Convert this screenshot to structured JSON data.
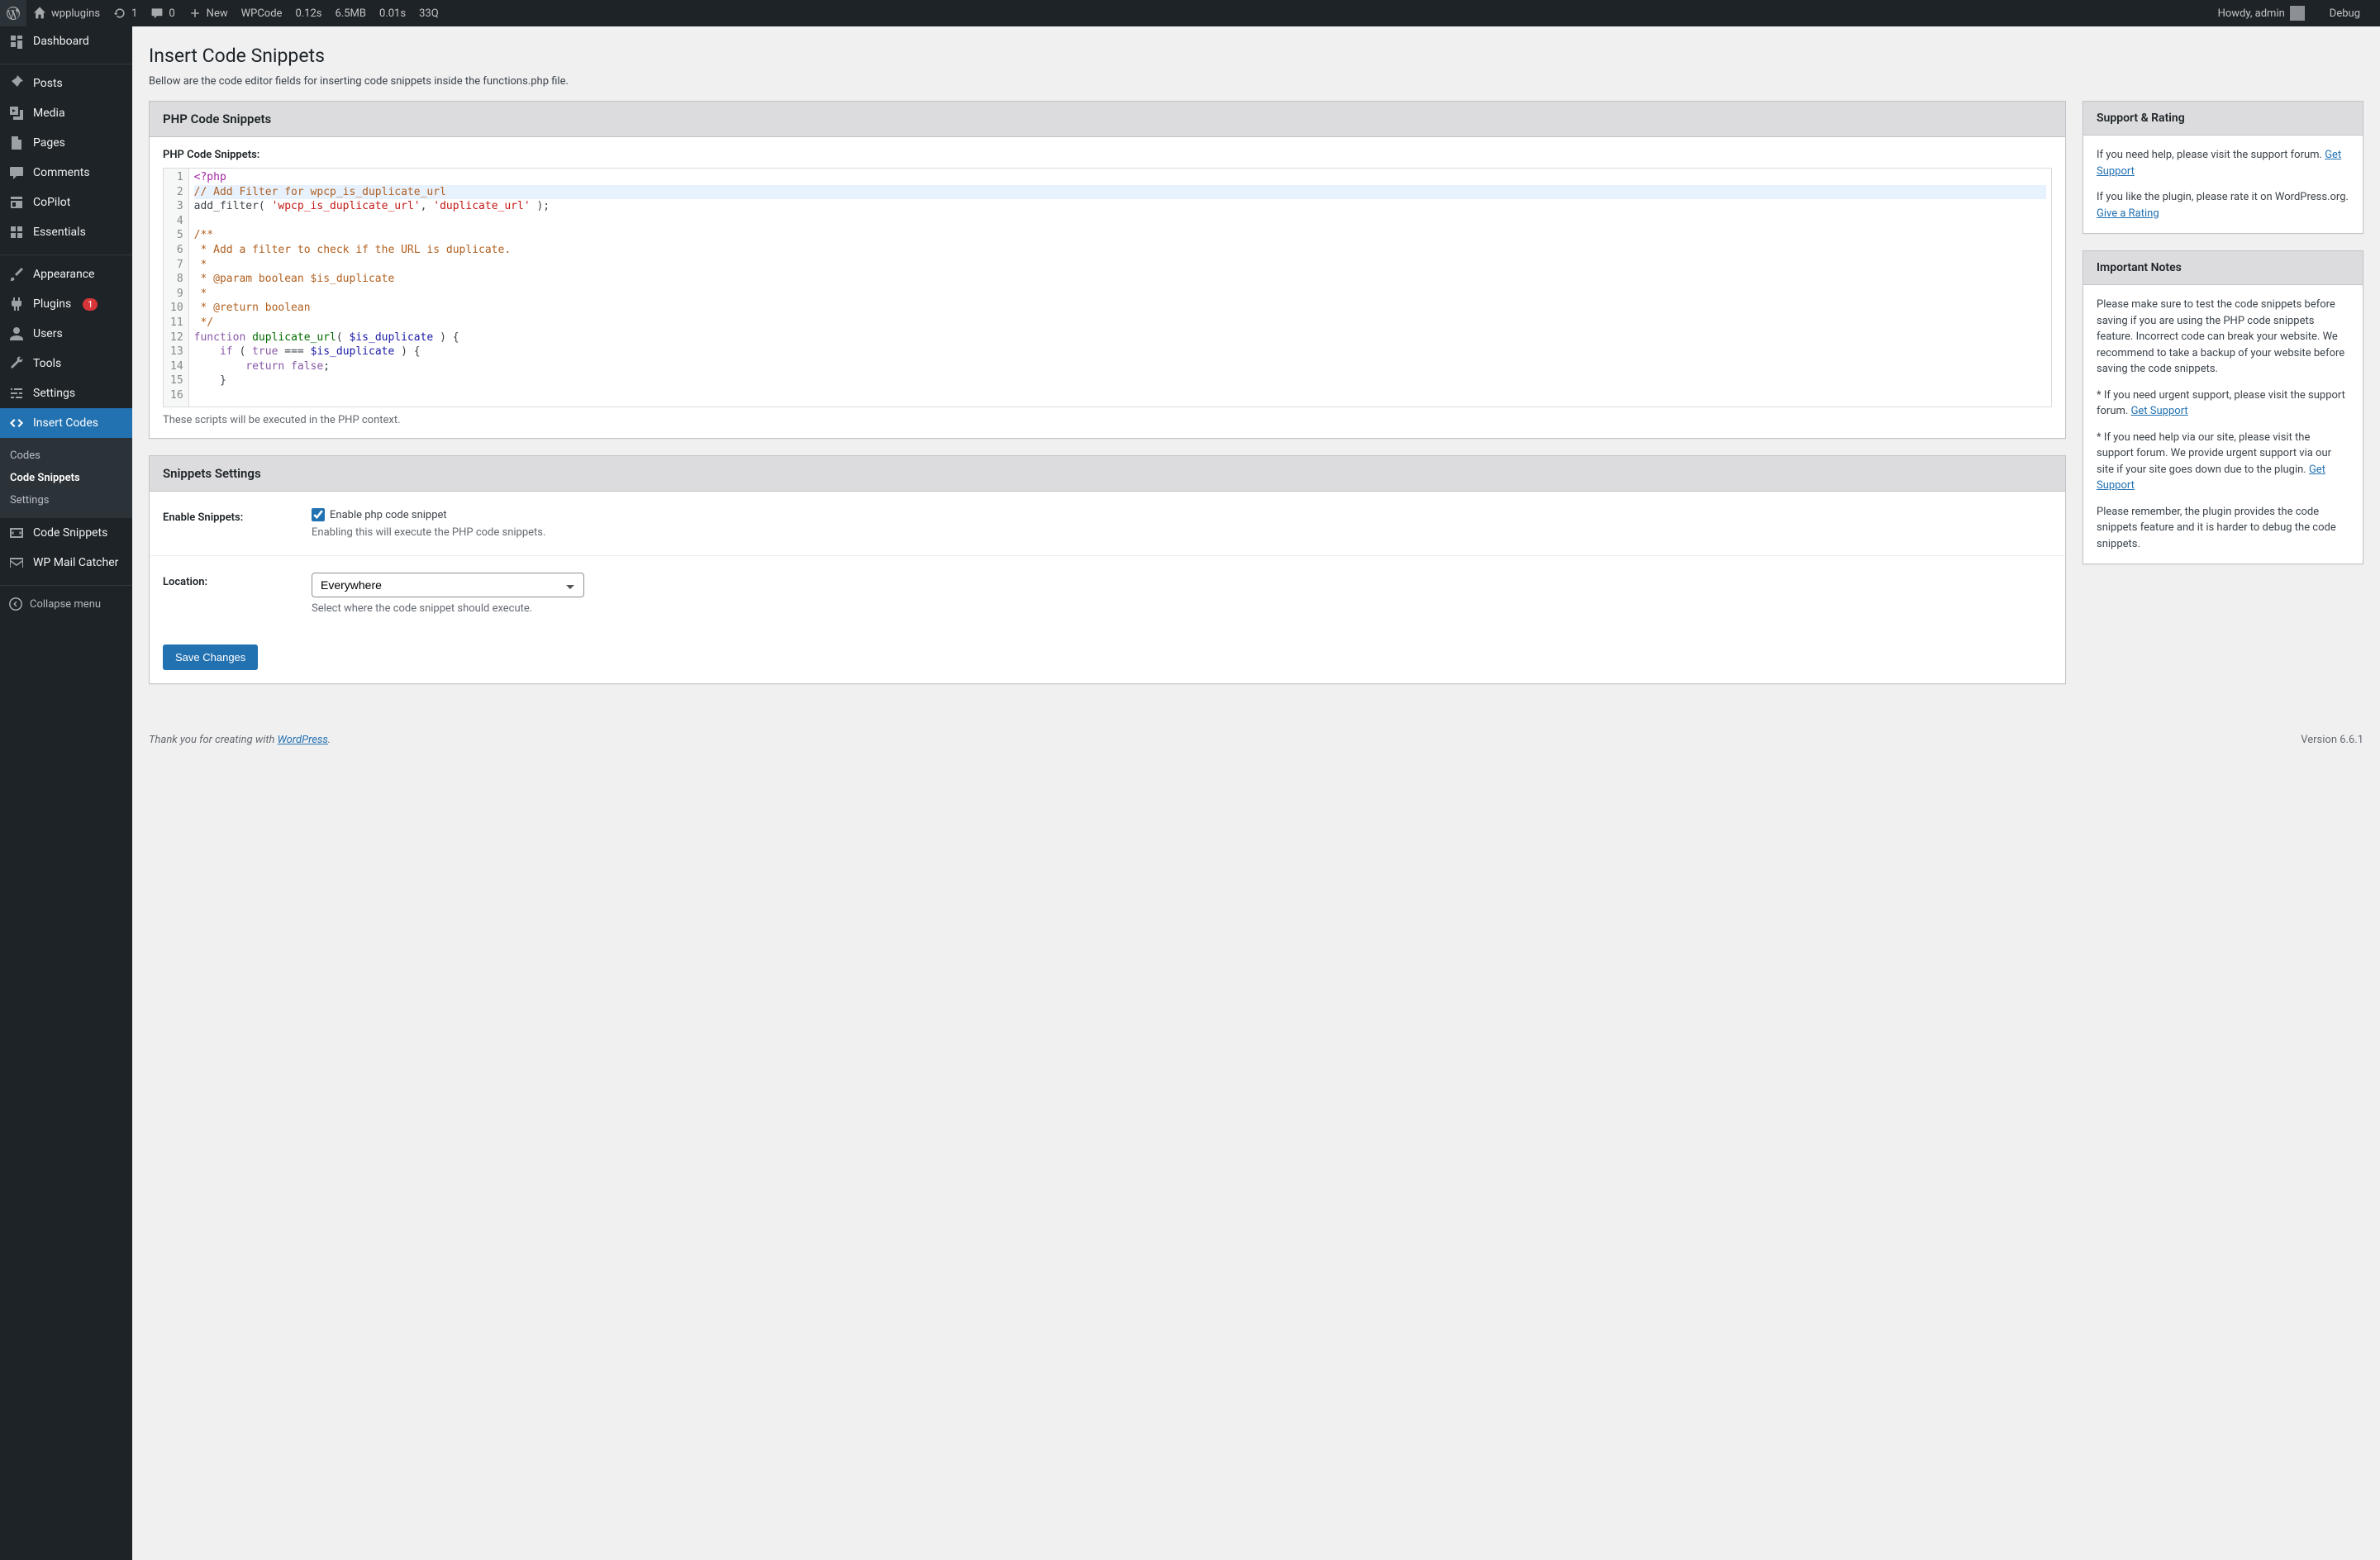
{
  "adminbar": {
    "site_name": "wpplugins",
    "updates": "1",
    "comments": "0",
    "new_label": "New",
    "wpcode_label": "WPCode",
    "perf_time": "0.12s",
    "perf_mem": "6.5MB",
    "perf_time2": "0.01s",
    "perf_queries": "33Q",
    "howdy": "Howdy, admin",
    "debug_label": "Debug"
  },
  "sidebar": {
    "items": [
      {
        "label": "Dashboard"
      },
      {
        "label": "Posts"
      },
      {
        "label": "Media"
      },
      {
        "label": "Pages"
      },
      {
        "label": "Comments"
      },
      {
        "label": "CoPilot"
      },
      {
        "label": "Essentials"
      },
      {
        "label": "Appearance"
      },
      {
        "label": "Plugins",
        "badge": "1"
      },
      {
        "label": "Users"
      },
      {
        "label": "Tools"
      },
      {
        "label": "Settings"
      },
      {
        "label": "Insert Codes"
      },
      {
        "label": "Code Snippets"
      },
      {
        "label": "WP Mail Catcher"
      }
    ],
    "submenu": [
      {
        "label": "Codes"
      },
      {
        "label": "Code Snippets"
      },
      {
        "label": "Settings"
      }
    ],
    "collapse_label": "Collapse menu"
  },
  "page": {
    "title": "Insert Code Snippets",
    "description": "Bellow are the code editor fields for inserting code snippets inside the functions.php file."
  },
  "main_box": {
    "header": "PHP Code Snippets",
    "field_label": "PHP Code Snippets:",
    "help_text": "These scripts will be executed in the PHP context."
  },
  "code": {
    "line1": "<?php",
    "line2": "// Add Filter for wpcp_is_duplicate_url",
    "line3_a": "add_filter( ",
    "line3_b": "'wpcp_is_duplicate_url'",
    "line3_c": ", ",
    "line3_d": "'duplicate_url'",
    "line3_e": " );",
    "line5": "/**",
    "line6": " * Add a filter to check if the URL is duplicate.",
    "line7": " *",
    "line8": " * @param boolean $is_duplicate",
    "line9": " *",
    "line10": " * @return boolean",
    "line11": " */",
    "line12_a": "function",
    "line12_b": " duplicate_url",
    "line12_c": "( ",
    "line12_d": "$is_duplicate",
    "line12_e": " ) {",
    "line13_a": "    if",
    "line13_b": " ( ",
    "line13_c": "true",
    "line13_d": " === ",
    "line13_e": "$is_duplicate",
    "line13_f": " ) {",
    "line14_a": "        return",
    "line14_b": " false",
    "line14_c": ";",
    "line15": "    }"
  },
  "settings_box": {
    "header": "Snippets Settings",
    "enable_label": "Enable Snippets:",
    "enable_checkbox_label": "Enable php code snippet",
    "enable_help": "Enabling this will execute the PHP code snippets.",
    "location_label": "Location:",
    "location_value": "Everywhere",
    "location_help": "Select where the code snippet should execute.",
    "save_button": "Save Changes"
  },
  "side_support": {
    "header": "Support & Rating",
    "p1": "If you need help, please visit the support forum. ",
    "link1": "Get Support",
    "p2": "If you like the plugin, please rate it on WordPress.org. ",
    "link2": "Give a Rating"
  },
  "side_notes": {
    "header": "Important Notes",
    "p1": "Please make sure to test the code snippets before saving if you are using the PHP code snippets feature. Incorrect code can break your website. We recommend to take a backup of your website before saving the code snippets.",
    "p2a": "* If you need urgent support, please visit the support forum. ",
    "p2link": "Get Support",
    "p3a": "* If you need help via our site, please visit the support forum. We provide urgent support via our site if your site goes down due to the plugin. ",
    "p3link": "Get Support",
    "p4": "Please remember, the plugin provides the code snippets feature and it is harder to debug the code snippets."
  },
  "footer": {
    "thanks_a": "Thank you for creating with ",
    "thanks_link": "WordPress",
    "thanks_b": ".",
    "version": "Version 6.6.1"
  }
}
